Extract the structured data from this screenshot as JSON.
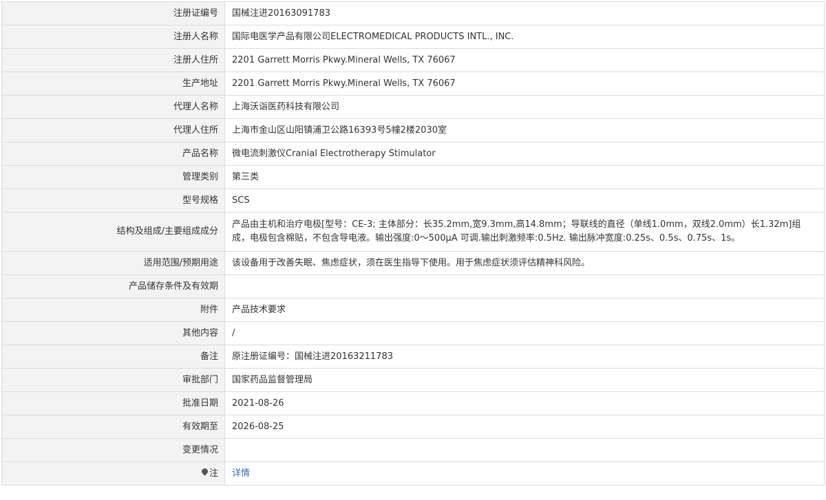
{
  "rows": [
    {
      "label": "注册证编号",
      "value": "国械注进20163091783"
    },
    {
      "label": "注册人名称",
      "value": "国际电医学产品有限公司ELECTROMEDICAL PRODUCTS INTL., INC."
    },
    {
      "label": "注册人住所",
      "value": "2201 Garrett Morris Pkwy.Mineral Wells, TX 76067"
    },
    {
      "label": "生产地址",
      "value": "2201 Garrett Morris Pkwy.Mineral Wells, TX 76067"
    },
    {
      "label": "代理人名称",
      "value": "上海沃诣医药科技有限公司"
    },
    {
      "label": "代理人住所",
      "value": "上海市金山区山阳镇浦卫公路16393号5幢2楼2030室"
    },
    {
      "label": "产品名称",
      "value": "微电流刺激仪Cranial Electrotherapy Stimulator"
    },
    {
      "label": "管理类别",
      "value": "第三类"
    },
    {
      "label": "型号规格",
      "value": "SCS"
    },
    {
      "label": "结构及组成/主要组成成分",
      "value": "产品由主机和治疗电极[型号：CE-3; 主体部分：长35.2mm,宽9.3mm,高14.8mm；导联线的直径（单线1.0mm，双线2.0mm）长1.32m]组成，电极包含棉贴，不包含导电液。输出强度:0～500μA 可调.输出刺激频率:0.5Hz. 输出脉冲宽度:0.25s、0.5s、0.75s、1s。"
    },
    {
      "label": "适用范围/预期用途",
      "value": "该设备用于改善失眠、焦虑症状，须在医生指导下使用。用于焦虑症状须评估精神科风险。"
    },
    {
      "label": "产品储存条件及有效期",
      "value": ""
    },
    {
      "label": "附件",
      "value": "产品技术要求"
    },
    {
      "label": "其他内容",
      "value": "/"
    },
    {
      "label": "备注",
      "value": "原注册证编号：国械注进20163211783"
    },
    {
      "label": "审批部门",
      "value": "国家药品监督管理局"
    },
    {
      "label": "批准日期",
      "value": "2021-08-26"
    },
    {
      "label": "有效期至",
      "value": "2026-08-25"
    },
    {
      "label": "变更情况",
      "value": ""
    }
  ],
  "note": {
    "icon": "map-pin-icon",
    "label": "注",
    "link_text": "详情",
    "link_color": "#2b6fb6"
  }
}
